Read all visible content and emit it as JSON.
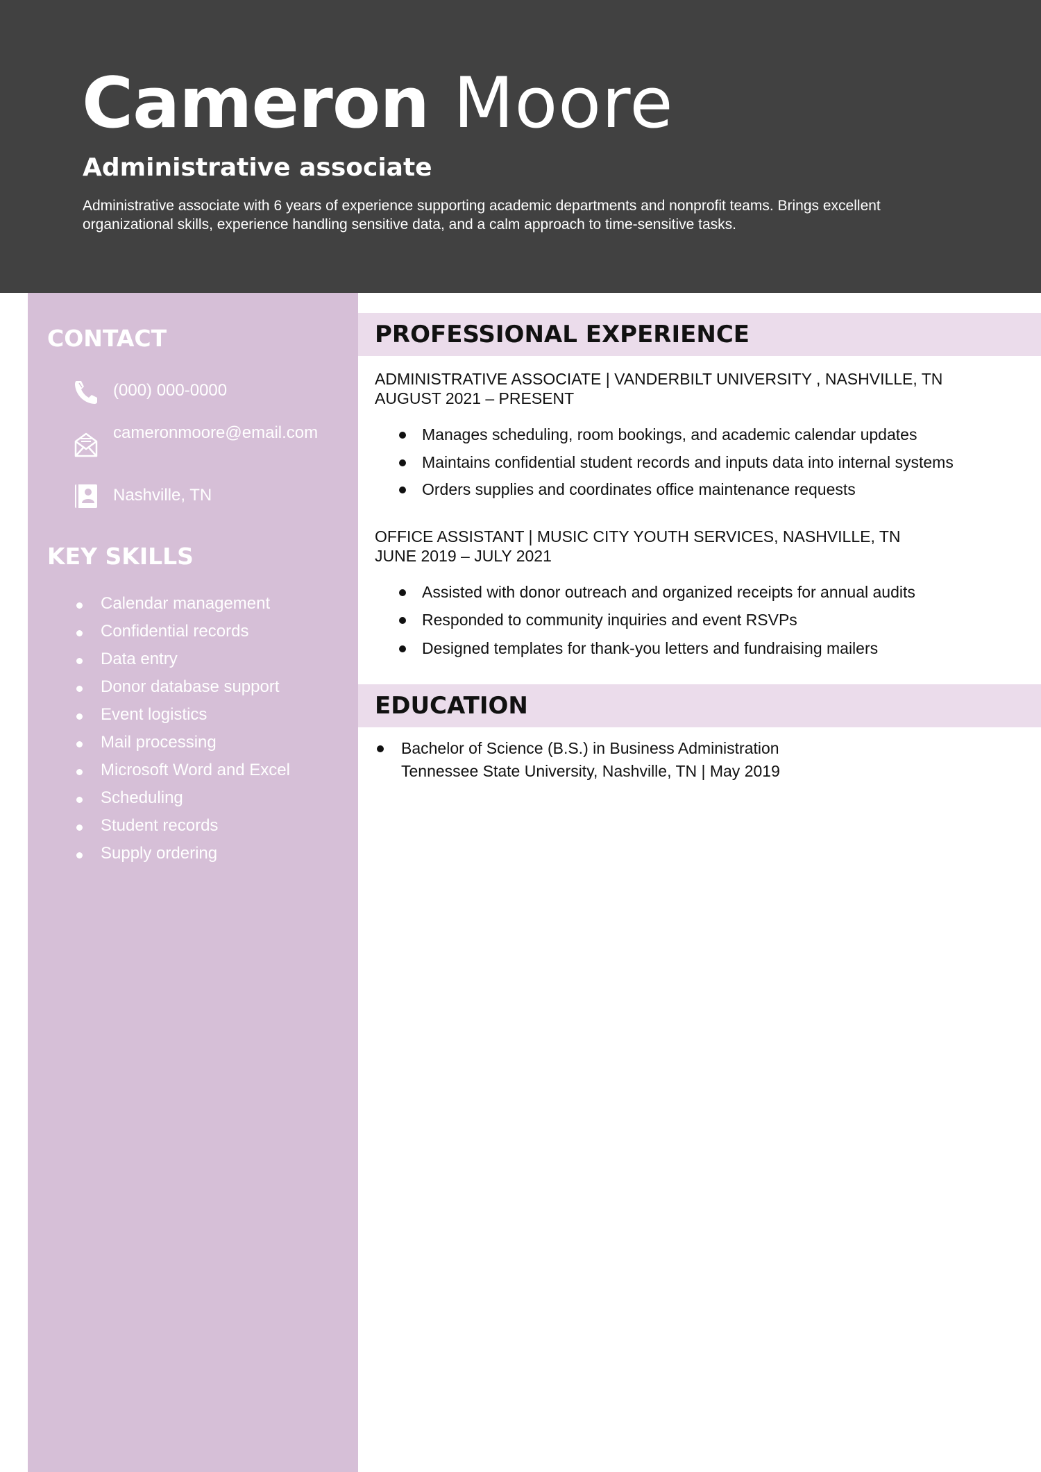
{
  "header": {
    "first_name": "Cameron",
    "last_name": "Moore",
    "job_title": "Administrative associate",
    "summary": "Administrative associate with 6 years of experience supporting academic departments and nonprofit teams. Brings excellent organizational skills, experience handling sensitive data, and a calm approach to time-sensitive tasks."
  },
  "sidebar": {
    "contact_heading": "CONTACT",
    "contact": {
      "phone": "(000) 000-0000",
      "email": "cameronmoore@email.com",
      "location": "Nashville, TN"
    },
    "contact_icons": [
      "phone-icon",
      "envelope-icon",
      "address-book-icon"
    ],
    "skills_heading": "KEY SKILLS",
    "skills": [
      "Calendar management",
      "Confidential records",
      "Data entry",
      "Donor database support",
      "Event logistics",
      "Mail processing",
      "Microsoft Word and Excel",
      "Scheduling",
      "Student records",
      "Supply ordering"
    ]
  },
  "experience": {
    "heading": "PROFESSIONAL EXPERIENCE",
    "jobs": [
      {
        "title_line": "ADMINISTRATIVE ASSOCIATE | VANDERBILT UNIVERSITY , NASHVILLE, TN",
        "dates": "AUGUST 2021 – PRESENT",
        "bullets": [
          "Manages scheduling, room bookings, and academic calendar updates",
          "Maintains confidential student records and inputs data into internal systems",
          "Orders supplies and coordinates office maintenance requests"
        ]
      },
      {
        "title_line": "OFFICE ASSISTANT | MUSIC CITY YOUTH SERVICES, NASHVILLE, TN",
        "dates": "JUNE 2019 – JULY 2021",
        "bullets": [
          "Assisted with donor outreach and organized receipts for annual audits",
          "Responded to community inquiries and event RSVPs",
          "Designed templates for thank-you letters and fundraising mailers"
        ]
      }
    ]
  },
  "education": {
    "heading": "EDUCATION",
    "degree": "Bachelor of Science (B.S.) in Business Administration",
    "school_line": "Tennessee State University, Nashville, TN | May 2019"
  },
  "colors": {
    "header_bg": "#414141",
    "sidebar_bg": "#d6bfd7",
    "section_band_bg": "#ebdceb",
    "text_dark": "#111111",
    "text_light": "#ffffff"
  }
}
